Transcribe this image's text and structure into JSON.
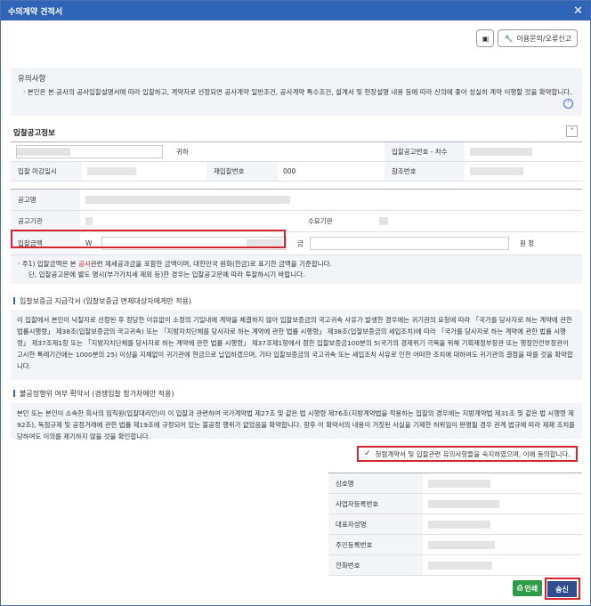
{
  "window": {
    "title": "수의계약 견적서"
  },
  "toolbar": {
    "help_label": "이용문의/오류신고"
  },
  "notice": {
    "title": "유의사항",
    "text": "본인은 본 공사의 공사입찰설명서에 따라 입찰하고, 계약자로 선정되면 공사계약 일반조건, 공사계약 특수조건, 설계서 및 현장설명 내용 등에 따라 신의에 좇아 성실히 계약 이행할 것을 확약합니다."
  },
  "bid_info": {
    "title": "입찰공고정보",
    "suffix": "귀하",
    "bid_no_label": "입찰공고번호 - 차수",
    "deadline_label": "입찰 마감일시",
    "rebid_label": "재입찰번호",
    "rebid_value": "000",
    "ref_label": "참조번호",
    "name_label": "공고명",
    "agency_label": "공고기관",
    "demand_label": "수요기관",
    "amount_label": "입찰금액",
    "currency": "W",
    "amount_kr_prefix": "금",
    "amount_kr_suffix": "원 정"
  },
  "note": {
    "line1_pre": "주1) 입찰금액은 본 ",
    "line1_hl": "공사",
    "line1_post": "관련 제세공과금을 포함한 금액이며, 대한민국 원화(한금)로 표기한 금액을 기준합니다.",
    "line2": "단, 입찰공고문에 별도 명시(부가가치세 제외 등)한 경우는 입찰공고문에 따라 투찰하시기 바랍니다."
  },
  "guarantee": {
    "title": "입찰보증금 지급각서 (입찰보증금 면제대상자에게만 적용)",
    "text": "이 입찰에서 본인이 낙찰자로 선정된 후 정당한 이유없이 소정의 기일내에 계약을 체결하지 않아 입찰보증금의 국고귀속 사유가 발생한 경우에는 귀기관의 요청에 따라 「국가를 당사자로 하는 계약에 관한 법률시행령」 제38조(입찰보증금의 국고귀속) 또는 「지방자치단체를 당사자로 하는 계약에 관한 법률 시행령」 제38조(입찰보증금의 세입조치)에 따라 「국가를 당사자로 하는 계약에 관한 법률 시행령」 제37조제1항 또는 「지방자치단체를 당사자로 하는 계약에 관한 법률 시행령」 제37조제1항에서 정한 입찰보증금100분의 5(국가의 경제위기 극복을 위해 기획재정부장관 또는 행정안전부장관이 고시한 특례기간에는 1000분의 25) 이상을 지체없이 귀기관에 현금으로 납입하겠으며, 기타 입찰보증금의 국고귀속 또는 세입조치 사유로 인한 어떠한 조치에 대하여도 귀기관의 결정을 따를 것을 확약합니다."
  },
  "fair_trade": {
    "title": "불공정행위 여부 확약서 (경쟁입찰 참가자에만 적용)",
    "text": "본인 또는 본인이 소속한 회사의 임직원(입찰대리인)이 이 입찰과 관련하여 국가계약법 제27조 및 같은 법 시행령 제76조(지방계약법을 적용하는 입찰의 경우에는 지방계약법 제31조 및 같은 법 시행령 제92조), 독점규제 및 공정거래에 관한 법률 제19조에 규정되어 있는 불공정 행위가 없었음을 확약합니다. 향후 이 확약서의 내용이 거짓된 사실을 기재한 허위임이 판명될 경우 관계 법규에 따라 제재 조치를 당하여도 이의를 제기하지 않을 것을 확인합니다."
  },
  "agree": {
    "label": "청렴계약서 및 입찰관련 유의사항들을 숙지하였으며, 이에 동의합니다."
  },
  "signer": {
    "company_label": "상호명",
    "bizno_label": "사업자등록번호",
    "ceo_label": "대표자성명",
    "rrn_label": "주민등록번호",
    "phone_label": "전화번호"
  },
  "actions": {
    "print_label": "인쇄",
    "send_label": "송신"
  }
}
